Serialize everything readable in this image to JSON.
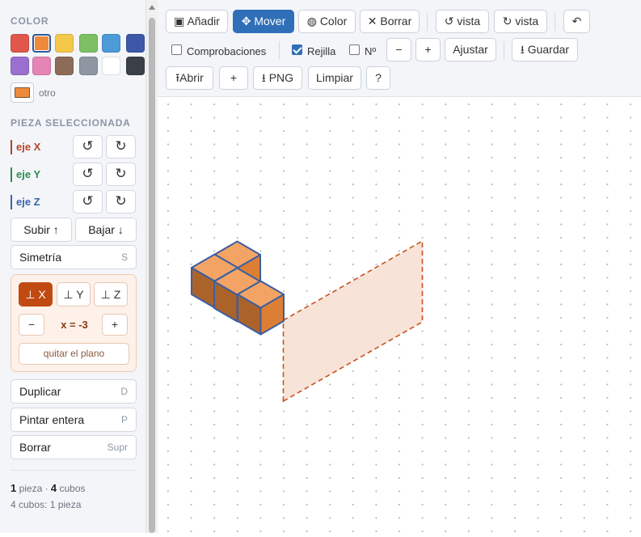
{
  "sidebar": {
    "color_title": "COLOR",
    "palette": [
      {
        "name": "red",
        "hex": "#e0574c"
      },
      {
        "name": "orange",
        "hex": "#ef8a3a",
        "selected": true
      },
      {
        "name": "yellow",
        "hex": "#f4c94a"
      },
      {
        "name": "green",
        "hex": "#7cc063"
      },
      {
        "name": "blue",
        "hex": "#4c9ad8"
      },
      {
        "name": "navy",
        "hex": "#3d58a8"
      },
      {
        "name": "purple",
        "hex": "#9b6fd0"
      },
      {
        "name": "pink",
        "hex": "#e485b5"
      },
      {
        "name": "brown",
        "hex": "#8c6b58"
      },
      {
        "name": "gray",
        "hex": "#8e96a2"
      },
      {
        "name": "white",
        "hex": "#ffffff"
      },
      {
        "name": "dark",
        "hex": "#3b4047"
      }
    ],
    "custom_color": {
      "label": "otro",
      "hex": "#ef8a3a"
    },
    "selected_title": "PIEZA SELECCIONADA",
    "axes": [
      {
        "label": "eje X",
        "color": "#b5452e",
        "ccw": "↺",
        "cw": "↻"
      },
      {
        "label": "eje Y",
        "color": "#2e8a4e",
        "ccw": "↺",
        "cw": "↻"
      },
      {
        "label": "eje Z",
        "color": "#3b64a8",
        "ccw": "↺",
        "cw": "↻"
      }
    ],
    "raise_label": "Subir ↑",
    "lower_label": "Bajar ↓",
    "symmetry_label": "Simetría",
    "symmetry_key": "S",
    "mirror": {
      "planes": [
        "⊥ X",
        "⊥ Y",
        "⊥ Z"
      ],
      "active_plane": "⊥ X",
      "minus": "−",
      "plus": "+",
      "value": "x = -3",
      "remove_label": "quitar el plano"
    },
    "duplicate_label": "Duplicar",
    "duplicate_key": "D",
    "paint_label": "Pintar entera",
    "paint_key": "P",
    "delete_label": "Borrar",
    "delete_key": "Supr",
    "stats": {
      "pieces_count": "1",
      "pieces_word": " pieza · ",
      "cubes_count": "4",
      "cubes_word": " cubos",
      "summary": "4 cubos: 1 pieza"
    }
  },
  "toolbar": {
    "add_label": "Añadir",
    "add_icon": "▣",
    "move_label": "Mover",
    "move_icon": "✥",
    "color_label": "Color",
    "color_icon": "◍",
    "erase_label": "Borrar",
    "erase_icon": "✕",
    "view_ccw_label": "vista",
    "view_ccw_icon": "↺",
    "view_cw_label": "vista",
    "view_cw_icon": "↻",
    "undo_icon": "↶",
    "checks_label": "Comprobaciones",
    "checks_on": false,
    "grid_label": "Rejilla",
    "grid_on": true,
    "numbers_label": "Nº",
    "numbers_on": false,
    "zoom_out": "−",
    "zoom_in": "+",
    "fit_label": "Ajustar",
    "save_label": "Guardar",
    "save_icon": "⭳",
    "open_label": "Abrir",
    "open_icon": "⭱",
    "new_label": "+",
    "png_label": "PNG",
    "png_icon": "⭳",
    "clear_label": "Limpiar",
    "help_label": "?"
  },
  "canvas": {
    "piece_color": "#ef8a3a",
    "edge_color": "#3b5fa0",
    "plane_fill": "#f8e3d9",
    "plane_stroke": "#c8521e",
    "dot_color": "#b7bcc4"
  }
}
